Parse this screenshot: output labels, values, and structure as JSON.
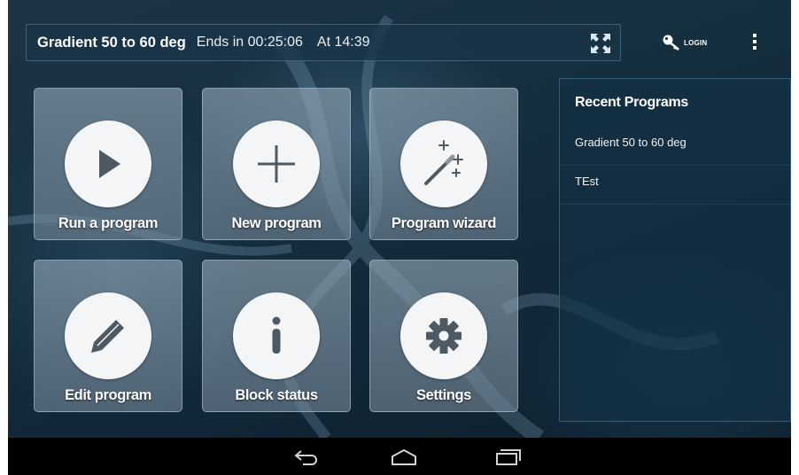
{
  "status_bar": {
    "program": "Gradient 50 to 60 deg",
    "ends": "Ends in 00:25:06",
    "at": "At 14:39",
    "fullscreen_icon": "fullscreen-icon"
  },
  "header": {
    "login_label": "LOGIN",
    "login_icon": "key-icon",
    "menu_icon": "overflow-menu-icon"
  },
  "tiles": [
    {
      "label": "Run a program",
      "icon": "play-icon"
    },
    {
      "label": "New program",
      "icon": "plus-icon"
    },
    {
      "label": "Program wizard",
      "icon": "magic-wand-icon"
    },
    {
      "label": "Edit program",
      "icon": "pencil-icon"
    },
    {
      "label": "Block status",
      "icon": "info-icon"
    },
    {
      "label": "Settings",
      "icon": "gear-icon"
    }
  ],
  "recent": {
    "title": "Recent Programs",
    "items": [
      "Gradient 50 to 60 deg",
      "TEst"
    ]
  },
  "nav": {
    "back_icon": "back-icon",
    "home_icon": "home-icon",
    "recents_icon": "recent-apps-icon"
  },
  "colors": {
    "background": "#163040",
    "tile": "#8a9cab",
    "icon_circle": "#f3f5f7",
    "icon_fg": "#4d5963"
  }
}
